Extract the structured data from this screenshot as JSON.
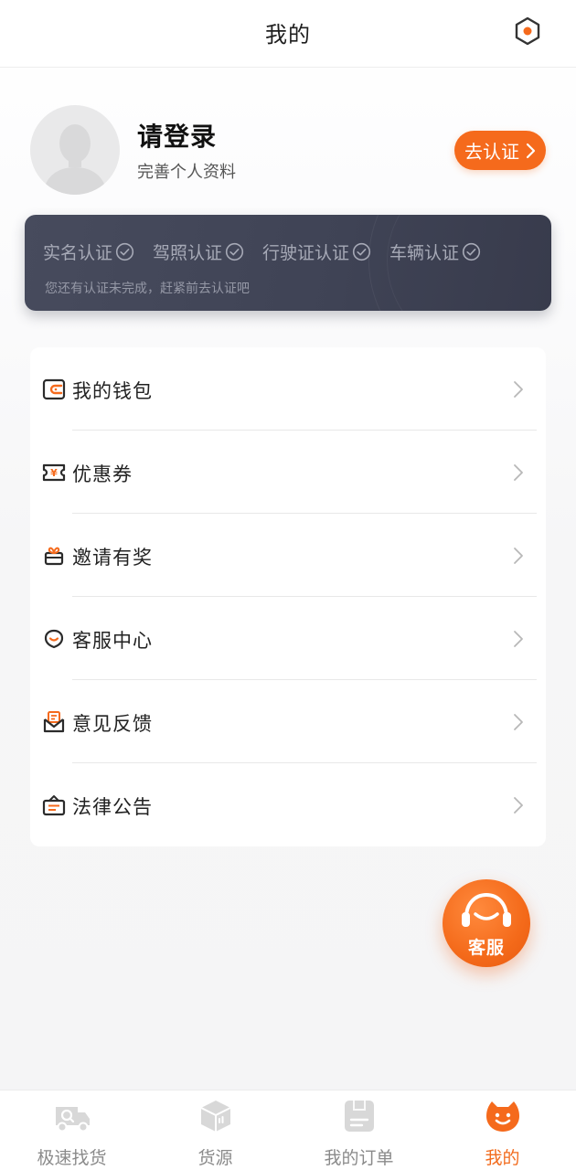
{
  "header": {
    "title": "我的",
    "settings_icon": "settings-hexagon-icon"
  },
  "profile": {
    "title": "请登录",
    "subtitle": "完善个人资料",
    "verify_button": "去认证",
    "avatar_icon": "default-avatar-icon"
  },
  "cert": {
    "items": [
      {
        "label": "实名认证",
        "icon": "check-circle-icon"
      },
      {
        "label": "驾照认证",
        "icon": "check-circle-icon"
      },
      {
        "label": "行驶证认证",
        "icon": "check-circle-icon"
      },
      {
        "label": "车辆认证",
        "icon": "check-circle-icon"
      }
    ],
    "note": "您还有认证未完成，赶紧前去认证吧"
  },
  "menu": {
    "items": [
      {
        "label": "我的钱包",
        "icon": "wallet-icon"
      },
      {
        "label": "优惠券",
        "icon": "coupon-icon"
      },
      {
        "label": "邀请有奖",
        "icon": "gift-icon"
      },
      {
        "label": "客服中心",
        "icon": "customer-service-icon"
      },
      {
        "label": "意见反馈",
        "icon": "feedback-icon"
      },
      {
        "label": "法律公告",
        "icon": "legal-notice-icon"
      }
    ]
  },
  "support_fab": {
    "label": "客服",
    "icon": "headset-icon"
  },
  "tabbar": {
    "items": [
      {
        "label": "极速找货",
        "icon": "truck-search-icon",
        "active": false
      },
      {
        "label": "货源",
        "icon": "cargo-box-icon",
        "active": false
      },
      {
        "label": "我的订单",
        "icon": "order-icon",
        "active": false
      },
      {
        "label": "我的",
        "icon": "smile-profile-icon",
        "active": true
      }
    ]
  },
  "colors": {
    "accent": "#f56a1c",
    "card_dark": "#424657",
    "tab_inactive": "#8a8a8a"
  }
}
